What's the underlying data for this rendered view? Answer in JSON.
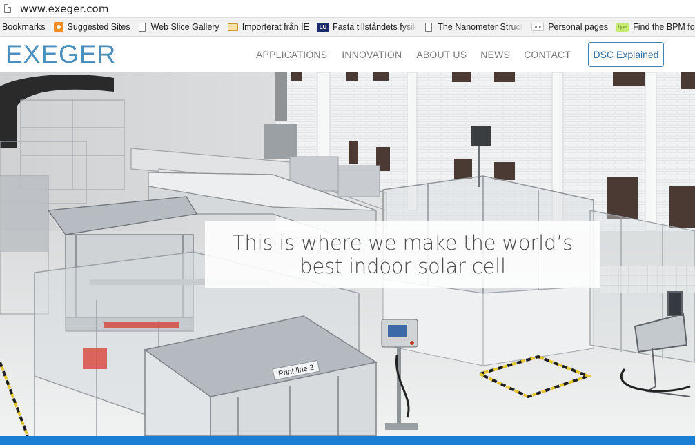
{
  "browser": {
    "url": "www.exeger.com",
    "bookmarks": [
      {
        "label": "Bookmarks",
        "icon": "none"
      },
      {
        "label": "Suggested Sites",
        "icon": "suggested-sites-icon"
      },
      {
        "label": "Web Slice Gallery",
        "icon": "page-icon"
      },
      {
        "label": "Importerat från IE",
        "icon": "folder-icon"
      },
      {
        "label": "Fasta tillståndets fysik",
        "icon": "lu-icon",
        "badge": "LU"
      },
      {
        "label": "The Nanometer Structure",
        "icon": "page-icon"
      },
      {
        "label": "Personal pages",
        "icon": "nmc-icon",
        "badge": "nmc"
      },
      {
        "label": "Find the BPM for any",
        "icon": "bpm-icon",
        "badge": "bpm"
      }
    ]
  },
  "site": {
    "logo": "EXEGER",
    "nav": [
      "APPLICATIONS",
      "INNOVATION",
      "ABOUT US",
      "NEWS",
      "CONTACT"
    ],
    "cta": "DSC Explained",
    "hero": {
      "line1": "This is where we make the world’s",
      "line2": "best indoor solar cell",
      "sign": "Print line 2"
    }
  },
  "colors": {
    "brand": "#4a8fbd",
    "cta_border": "#3f83b5",
    "bottom_bar": "#1a7fd4"
  }
}
